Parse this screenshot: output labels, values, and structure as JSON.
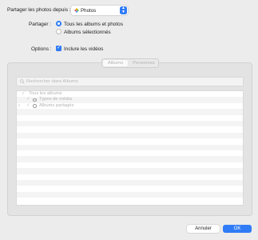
{
  "share": {
    "from_label": "Partager les photos depuis :",
    "from_value": "Photos",
    "share_label": "Partager :",
    "option_all": "Tous les albums et photos",
    "option_selected": "Albums sélectionnés",
    "options_label": "Options :",
    "include_videos": "Inclure les vidéos"
  },
  "tabs": [
    "Albums",
    "Personnes"
  ],
  "search": {
    "placeholder": "Rechercher dans Albums"
  },
  "tree": [
    {
      "label": "Tous les albums"
    },
    {
      "label": "Types de média"
    },
    {
      "label": "Albums partagés"
    }
  ],
  "buttons": {
    "cancel": "Annuler",
    "ok": "OK"
  },
  "colors": {
    "accent": "#2f7cf6",
    "background": "#ececec"
  }
}
